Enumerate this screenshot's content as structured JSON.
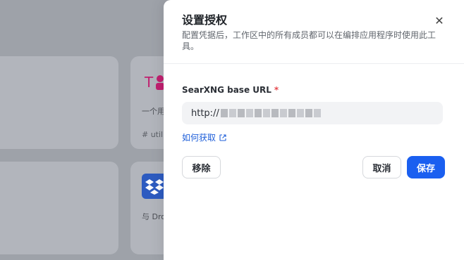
{
  "background": {
    "card_desc": "一个用",
    "card_tag": "# util",
    "dropbox_text": "与 Dro"
  },
  "modal": {
    "title": "设置授权",
    "subtitle": "配置凭据后，工作区中的所有成员都可以在编排应用程序时使用此工具。",
    "close_icon": "close-icon",
    "field": {
      "label": "SearXNG base URL",
      "required_mark": "*",
      "value_prefix": "http://"
    },
    "help_link": {
      "label": "如何获取",
      "icon": "external-link-icon"
    },
    "actions": {
      "remove_label": "移除",
      "cancel_label": "取消",
      "save_label": "保存"
    }
  },
  "colors": {
    "primary": "#1a5ff0",
    "link": "#1f5fd9",
    "required": "#e5484d",
    "overlay": "#9ea2a9"
  }
}
